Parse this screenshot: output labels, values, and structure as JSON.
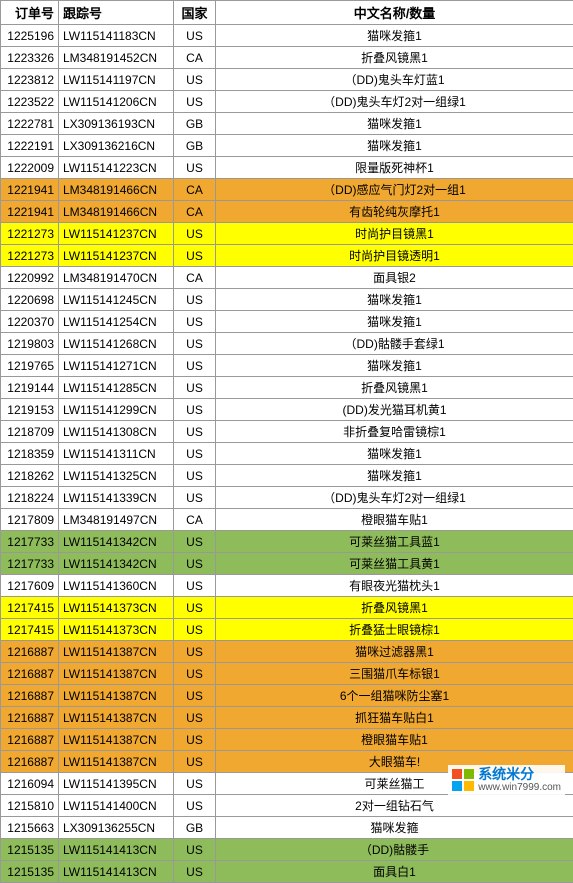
{
  "headers": {
    "order": "订单号",
    "track": "跟踪号",
    "country": "国家",
    "desc": "中文名称/数量"
  },
  "rows": [
    {
      "order": "1225196",
      "track": "LW115141183CN",
      "country": "US",
      "desc": "猫咪发箍1",
      "color": "white"
    },
    {
      "order": "1223326",
      "track": "LM348191452CN",
      "country": "CA",
      "desc": "折叠风镜黑1",
      "color": "white"
    },
    {
      "order": "1223812",
      "track": "LW115141197CN",
      "country": "US",
      "desc": "（DD)鬼头车灯蓝1",
      "color": "white"
    },
    {
      "order": "1223522",
      "track": "LW115141206CN",
      "country": "US",
      "desc": "（DD)鬼头车灯2对一组绿1",
      "color": "white"
    },
    {
      "order": "1222781",
      "track": "LX309136193CN",
      "country": "GB",
      "desc": "猫咪发箍1",
      "color": "white"
    },
    {
      "order": "1222191",
      "track": "LX309136216CN",
      "country": "GB",
      "desc": "猫咪发箍1",
      "color": "white"
    },
    {
      "order": "1222009",
      "track": "LW115141223CN",
      "country": "US",
      "desc": "限量版死神杯1",
      "color": "white"
    },
    {
      "order": "1221941",
      "track": "LM348191466CN",
      "country": "CA",
      "desc": "（DD)感应气门灯2对一组1",
      "color": "orange"
    },
    {
      "order": "1221941",
      "track": "LM348191466CN",
      "country": "CA",
      "desc": "有齿轮纯灰摩托1",
      "color": "orange"
    },
    {
      "order": "1221273",
      "track": "LW115141237CN",
      "country": "US",
      "desc": "时尚护目镜黑1",
      "color": "yellow"
    },
    {
      "order": "1221273",
      "track": "LW115141237CN",
      "country": "US",
      "desc": "时尚护目镜透明1",
      "color": "yellow"
    },
    {
      "order": "1220992",
      "track": "LM348191470CN",
      "country": "CA",
      "desc": "面具银2",
      "color": "white"
    },
    {
      "order": "1220698",
      "track": "LW115141245CN",
      "country": "US",
      "desc": "猫咪发箍1",
      "color": "white"
    },
    {
      "order": "1220370",
      "track": "LW115141254CN",
      "country": "US",
      "desc": "猫咪发箍1",
      "color": "white"
    },
    {
      "order": "1219803",
      "track": "LW115141268CN",
      "country": "US",
      "desc": "（DD)骷髅手套绿1",
      "color": "white"
    },
    {
      "order": "1219765",
      "track": "LW115141271CN",
      "country": "US",
      "desc": "猫咪发箍1",
      "color": "white"
    },
    {
      "order": "1219144",
      "track": "LW115141285CN",
      "country": "US",
      "desc": "折叠风镜黑1",
      "color": "white"
    },
    {
      "order": "1219153",
      "track": "LW115141299CN",
      "country": "US",
      "desc": "(DD)发光猫耳机黄1",
      "color": "white"
    },
    {
      "order": "1218709",
      "track": "LW115141308CN",
      "country": "US",
      "desc": "非折叠复哈雷镜棕1",
      "color": "white"
    },
    {
      "order": "1218359",
      "track": "LW115141311CN",
      "country": "US",
      "desc": "猫咪发箍1",
      "color": "white"
    },
    {
      "order": "1218262",
      "track": "LW115141325CN",
      "country": "US",
      "desc": "猫咪发箍1",
      "color": "white"
    },
    {
      "order": "1218224",
      "track": "LW115141339CN",
      "country": "US",
      "desc": "（DD)鬼头车灯2对一组绿1",
      "color": "white"
    },
    {
      "order": "1217809",
      "track": "LM348191497CN",
      "country": "CA",
      "desc": "橙眼猫车贴1",
      "color": "white"
    },
    {
      "order": "1217733",
      "track": "LW115141342CN",
      "country": "US",
      "desc": "可莱丝猫工具蓝1",
      "color": "green"
    },
    {
      "order": "1217733",
      "track": "LW115141342CN",
      "country": "US",
      "desc": "可莱丝猫工具黄1",
      "color": "green"
    },
    {
      "order": "1217609",
      "track": "LW115141360CN",
      "country": "US",
      "desc": "有眼夜光猫枕头1",
      "color": "white"
    },
    {
      "order": "1217415",
      "track": "LW115141373CN",
      "country": "US",
      "desc": "折叠风镜黑1",
      "color": "yellow"
    },
    {
      "order": "1217415",
      "track": "LW115141373CN",
      "country": "US",
      "desc": "折叠猛士眼镜棕1",
      "color": "yellow"
    },
    {
      "order": "1216887",
      "track": "LW115141387CN",
      "country": "US",
      "desc": "猫咪过滤器黑1",
      "color": "orange"
    },
    {
      "order": "1216887",
      "track": "LW115141387CN",
      "country": "US",
      "desc": "三围猫爪车标银1",
      "color": "orange"
    },
    {
      "order": "1216887",
      "track": "LW115141387CN",
      "country": "US",
      "desc": "6个一组猫咪防尘塞1",
      "color": "orange"
    },
    {
      "order": "1216887",
      "track": "LW115141387CN",
      "country": "US",
      "desc": "抓狂猫车贴白1",
      "color": "orange"
    },
    {
      "order": "1216887",
      "track": "LW115141387CN",
      "country": "US",
      "desc": "橙眼猫车贴1",
      "color": "orange"
    },
    {
      "order": "1216887",
      "track": "LW115141387CN",
      "country": "US",
      "desc": "大眼猫车!",
      "color": "orange"
    },
    {
      "order": "1216094",
      "track": "LW115141395CN",
      "country": "US",
      "desc": "可莱丝猫工",
      "color": "white"
    },
    {
      "order": "1215810",
      "track": "LW115141400CN",
      "country": "US",
      "desc": "2对一组钻石气",
      "color": "white"
    },
    {
      "order": "1215663",
      "track": "LX309136255CN",
      "country": "GB",
      "desc": "猫咪发箍",
      "color": "white"
    },
    {
      "order": "1215135",
      "track": "LW115141413CN",
      "country": "US",
      "desc": "（DD)骷髅手",
      "color": "green"
    },
    {
      "order": "1215135",
      "track": "LW115141413CN",
      "country": "US",
      "desc": "面具白1",
      "color": "green"
    }
  ],
  "watermark": {
    "brand": "系统米分",
    "url": "www.win7999.com"
  }
}
